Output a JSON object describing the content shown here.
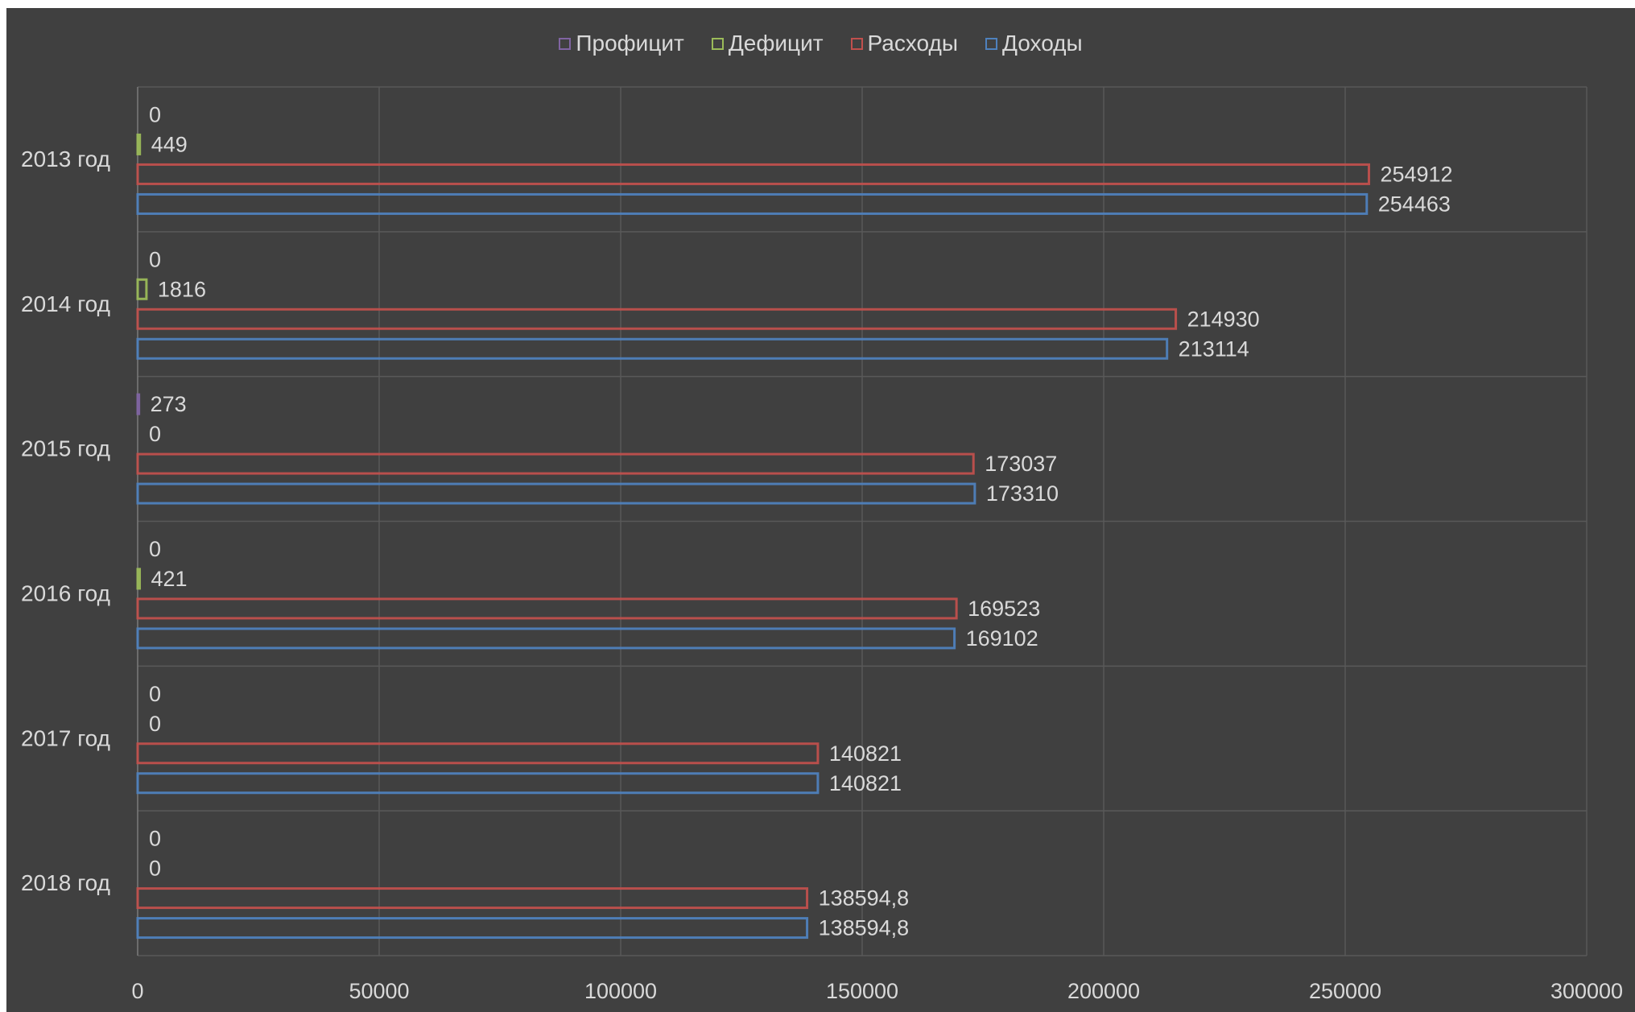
{
  "chart_data": {
    "type": "bar",
    "orientation": "horizontal",
    "categories": [
      "2013 год",
      "2014 год",
      "2015 год",
      "2016 год",
      "2017 год",
      "2018 год"
    ],
    "series": [
      {
        "name": "Профицит",
        "color": "#8064a2",
        "values": [
          0,
          0,
          273,
          0,
          0,
          0
        ],
        "labels": [
          "0",
          "0",
          "273",
          "0",
          "0",
          "0"
        ]
      },
      {
        "name": "Дефицит",
        "color": "#9bbb59",
        "values": [
          449,
          1816,
          0,
          421,
          0,
          0
        ],
        "labels": [
          "449",
          "1816",
          "0",
          "421",
          "0",
          "0"
        ]
      },
      {
        "name": "Расходы",
        "color": "#c0504d",
        "values": [
          254912,
          214930,
          173037,
          169523,
          140821,
          138594.8
        ],
        "labels": [
          "254912",
          "214930",
          "173037",
          "169523",
          "140821",
          "138594,8"
        ]
      },
      {
        "name": "Доходы",
        "color": "#4f81bd",
        "values": [
          254463,
          213114,
          173310,
          169102,
          140821,
          138594.8
        ],
        "labels": [
          "254463",
          "213114",
          "173310",
          "169102",
          "140821",
          "138594,8"
        ]
      }
    ],
    "xlim": [
      0,
      300000
    ],
    "xticks": [
      "0",
      "50000",
      "100000",
      "150000",
      "200000",
      "250000",
      "300000"
    ],
    "grid": true,
    "legend_position": "top"
  }
}
